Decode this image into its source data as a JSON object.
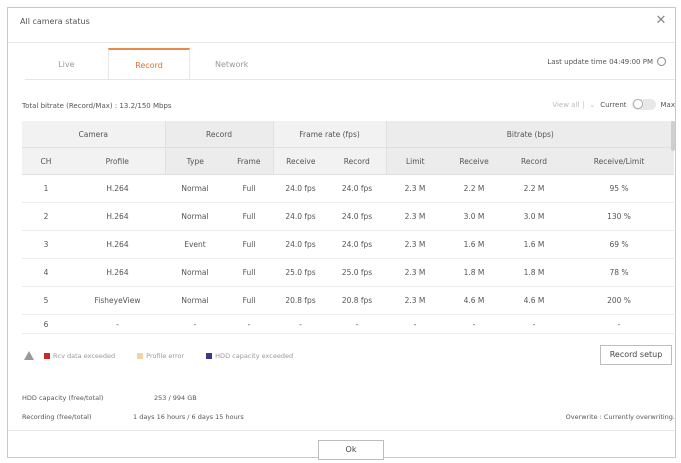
{
  "dialog": {
    "title": "All camera status",
    "close_icon": "close-icon",
    "ok_label": "Ok"
  },
  "tabs": [
    {
      "label": "Live",
      "active": false
    },
    {
      "label": "Record",
      "active": true
    },
    {
      "label": "Network",
      "active": false
    }
  ],
  "last_update": "Last update time 04:49:00 PM",
  "total_bitrate": "Total bitrate (Record/Max) : 13.2/150 Mbps",
  "controls": {
    "view_all": "View all",
    "current_label": "Current",
    "max_label": "Max"
  },
  "table": {
    "groups": [
      "Camera",
      "Record",
      "Frame rate (fps)",
      "Bitrate (bps)"
    ],
    "columns": [
      "CH",
      "Profile",
      "Type",
      "Frame",
      "Receive",
      "Record",
      "Limit",
      "Receive",
      "Record",
      "Receive/Limit"
    ],
    "rows": [
      [
        "1",
        "H.264",
        "Normal",
        "Full",
        "24.0 fps",
        "24.0 fps",
        "2.3 M",
        "2.2 M",
        "2.2 M",
        "95 %"
      ],
      [
        "2",
        "H.264",
        "Normal",
        "Full",
        "24.0 fps",
        "24.0 fps",
        "2.3 M",
        "3.0 M",
        "3.0 M",
        "130 %"
      ],
      [
        "3",
        "H.264",
        "Event",
        "Full",
        "24.0 fps",
        "24.0 fps",
        "2.3 M",
        "1.6 M",
        "1.6 M",
        "69 %"
      ],
      [
        "4",
        "H.264",
        "Normal",
        "Full",
        "25.0 fps",
        "25.0 fps",
        "2.3 M",
        "1.8 M",
        "1.8 M",
        "78 %"
      ],
      [
        "5",
        "FisheyeView",
        "Normal",
        "Full",
        "20.8 fps",
        "20.8 fps",
        "2.3 M",
        "4.6 M",
        "4.6 M",
        "200 %"
      ],
      [
        "6",
        "-",
        "-",
        "-",
        "-",
        "-",
        "-",
        "-",
        "-",
        "-"
      ]
    ]
  },
  "legend": {
    "rcv": {
      "label": "Rcv data exceeded",
      "color": "#cc2a2a"
    },
    "profile": {
      "label": "Profile error",
      "color": "#f5d4a0"
    },
    "hdd": {
      "label": "HDD capacity exceeded",
      "color": "#3a3a8a"
    }
  },
  "record_setup_label": "Record setup",
  "hdd": {
    "label": "HDD capacity (free/total)",
    "value": "253 / 994 GB"
  },
  "recording": {
    "label": "Recording (free/total)",
    "value": "1 days 16 hours / 6 days 15 hours"
  },
  "overwrite": "Overwrite : Currently overwriting."
}
